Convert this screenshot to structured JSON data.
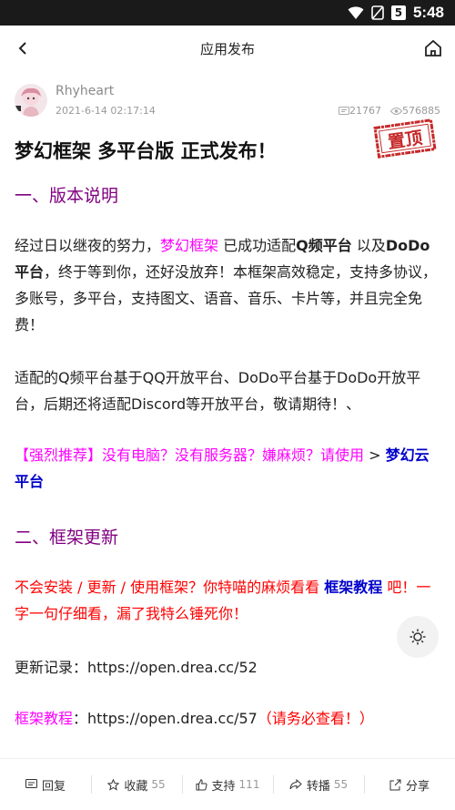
{
  "status_bar": {
    "time": "5:48"
  },
  "app_bar": {
    "title": "应用发布"
  },
  "post": {
    "author": "Rhyheart",
    "date": "2021-6-14 02:17:14",
    "comments": "21767",
    "views": "576885",
    "pin_label": "置顶",
    "title": "梦幻框架 多平台版 正式发布！"
  },
  "section1": {
    "heading": "一、版本说明",
    "p1": {
      "t1": "经过日以继夜的努力，",
      "framework": "梦幻框架",
      "t2": "已成功适配",
      "qpin": "Q频平台",
      "t3": "以及",
      "dodo": "DoDo平台",
      "t4": "，终于等到你，还好没放弃！本框架高效稳定，支持多协议，多账号，多平台，支持图文、语音、音乐、卡片等，并且完全免费！"
    },
    "p2": "适配的Q频平台基于QQ开放平台、DoDo平台基于DoDo开放平台，后期还将适配Discord等开放平台，敬请期待！、",
    "p3": {
      "recommend": "【强烈推荐】没有电脑？没有服务器？嫌麻烦？请使用",
      "arrow": ">",
      "cloud": "梦幻云平台"
    }
  },
  "section2": {
    "heading": "二、框架更新",
    "p1": {
      "red1": "不会安装 / 更新 / 使用框架？你特喵的麻烦看看",
      "tutorial": "框架教程",
      "red2": "吧！一字一句仔细看，漏了我特么锤死你！"
    },
    "changelog": {
      "label": "更新记录：",
      "url": "https://open.drea.cc/52"
    },
    "tutorial_link": {
      "label": "框架教程",
      "colon": "：",
      "url": "https://open.drea.cc/57",
      "note": "（请务必查看！）"
    }
  },
  "bottom_bar": {
    "reply": "回复",
    "favorite": "收藏",
    "favorite_count": "55",
    "support": "支持",
    "support_count": "111",
    "repost": "转播",
    "repost_count": "55",
    "share": "分享"
  }
}
